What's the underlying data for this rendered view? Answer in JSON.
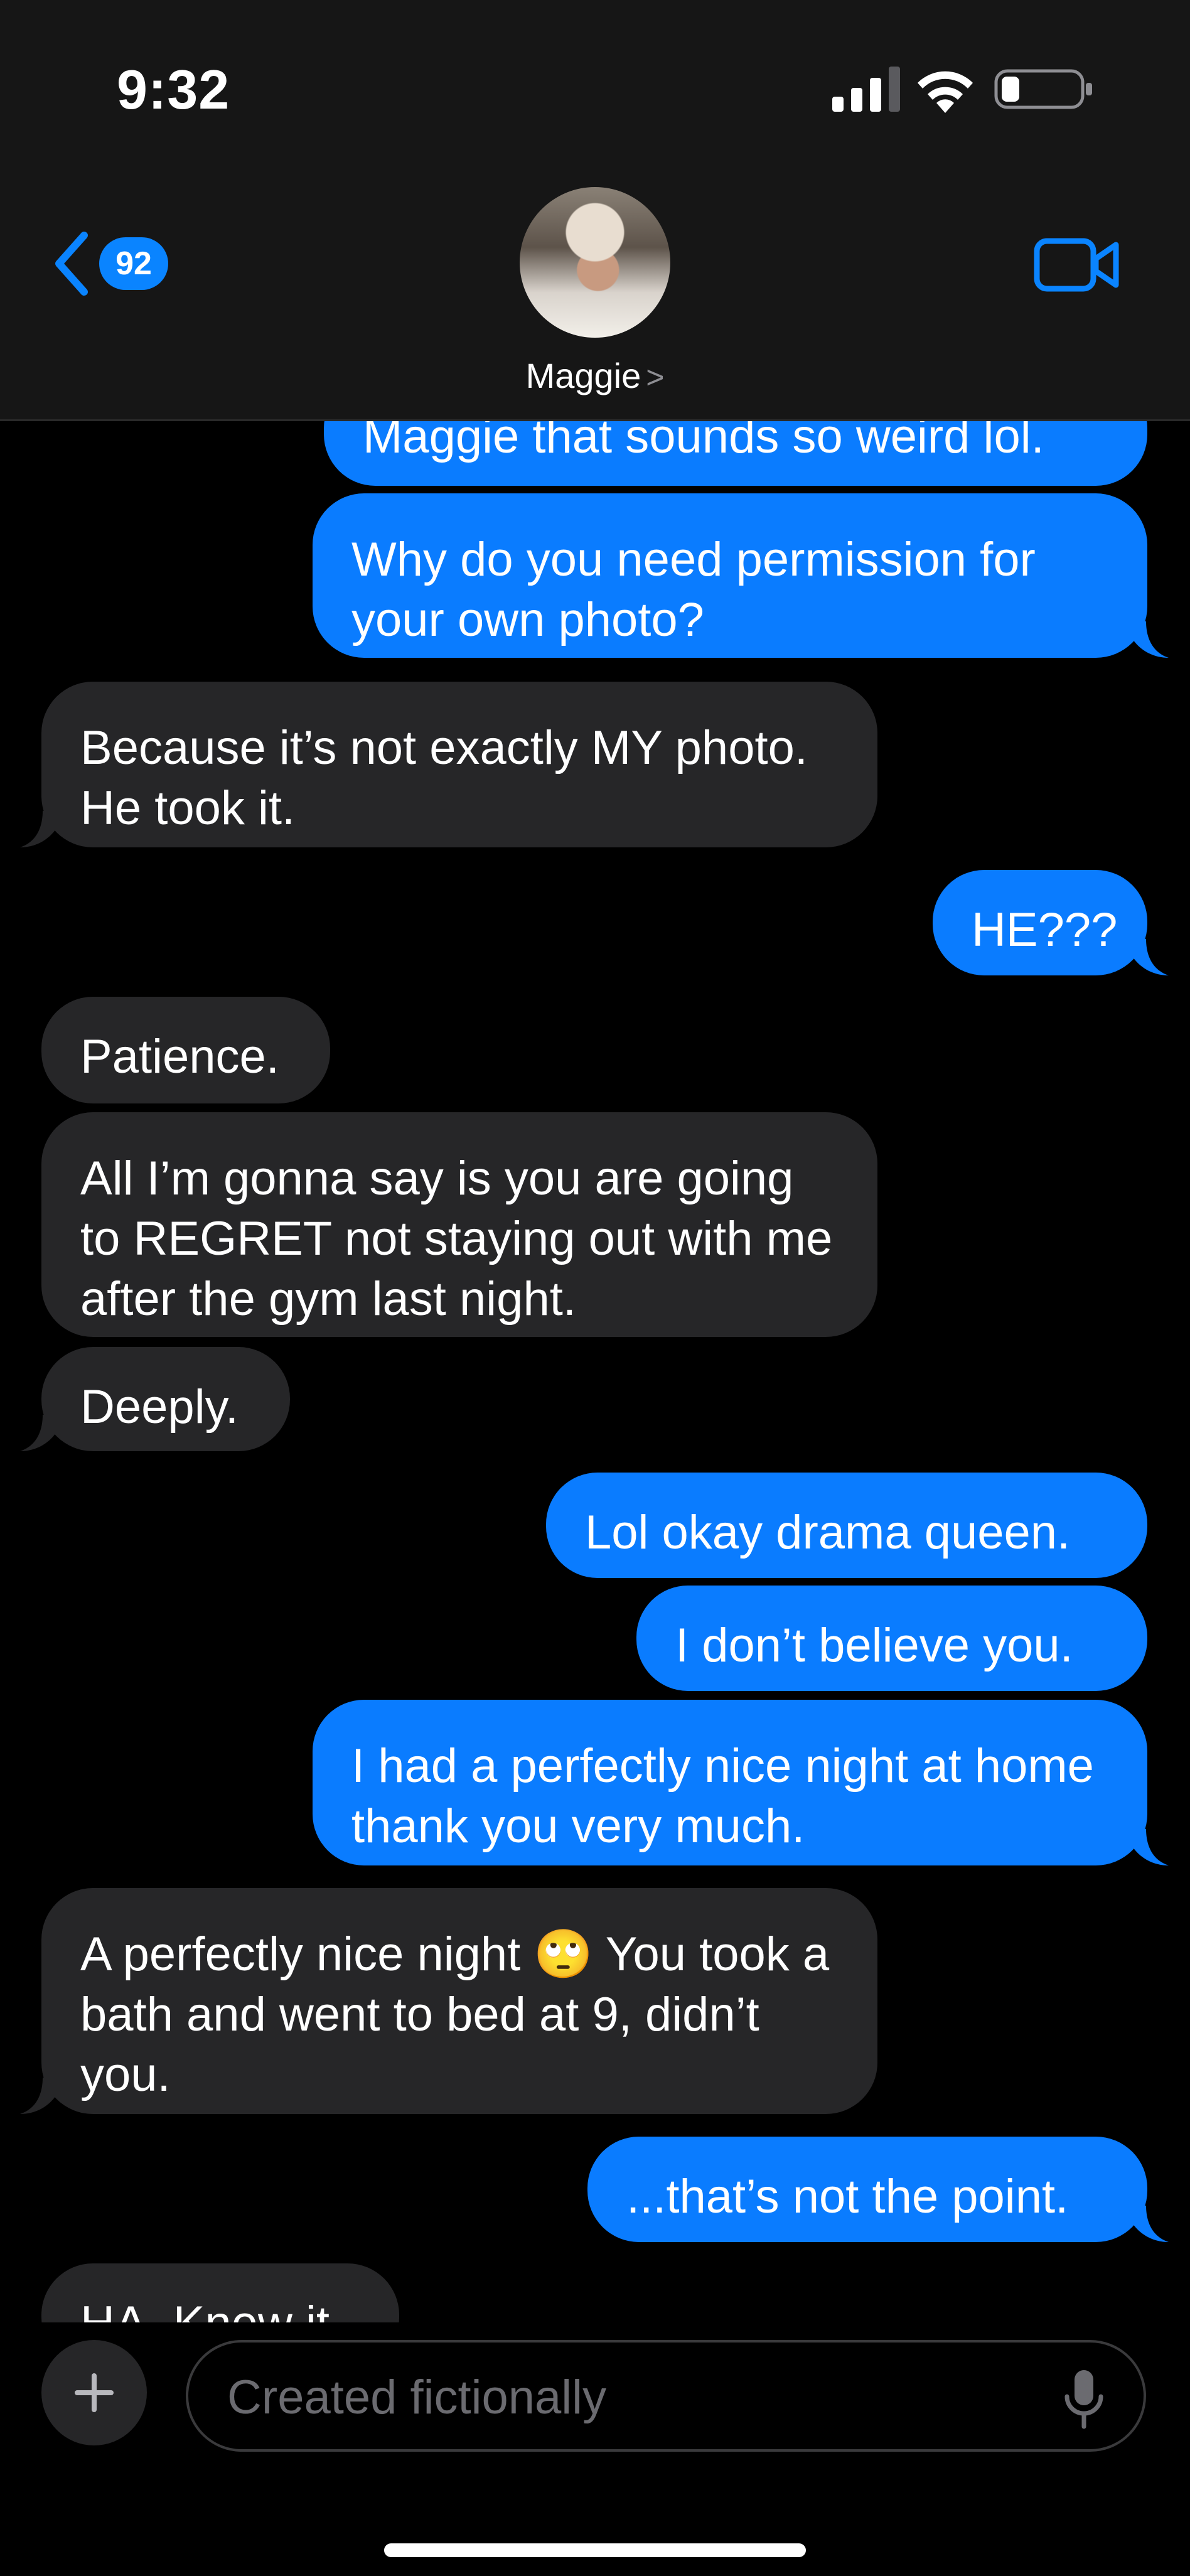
{
  "status_bar": {
    "time": "9:32"
  },
  "header": {
    "back_badge": "92",
    "contact_name": "Maggie",
    "chevron": ">"
  },
  "colors": {
    "outgoing": "#0a7cff",
    "incoming": "#262628",
    "accent": "#0a84ff"
  },
  "icons": [
    "signal-icon",
    "wifi-icon",
    "battery-icon",
    "back-chevron-icon",
    "video-call-icon",
    "plus-icon",
    "microphone-icon"
  ],
  "messages": [
    {
      "from": "me",
      "text": "Maggie that sounds so weird lol."
    },
    {
      "from": "me",
      "text": "Why do you need permission for your own photo?"
    },
    {
      "from": "them",
      "text": "Because it’s not exactly MY photo. He took it."
    },
    {
      "from": "me",
      "text": "HE???"
    },
    {
      "from": "them",
      "text": "Patience."
    },
    {
      "from": "them",
      "text": "All I’m gonna say is you are going to REGRET not staying out with me after the gym last night."
    },
    {
      "from": "them",
      "text": "Deeply."
    },
    {
      "from": "me",
      "text": "Lol okay drama queen."
    },
    {
      "from": "me",
      "text": "I don’t believe you."
    },
    {
      "from": "me",
      "text": "I had a perfectly nice night at home thank you very much."
    },
    {
      "from": "them",
      "text": "A perfectly nice night 🙄 You took a bath and went to bed at 9, didn’t you."
    },
    {
      "from": "me",
      "text": "...that’s not the point."
    },
    {
      "from": "them",
      "text": "HA. Knew it."
    }
  ],
  "composer": {
    "placeholder": "Created fictionally"
  }
}
